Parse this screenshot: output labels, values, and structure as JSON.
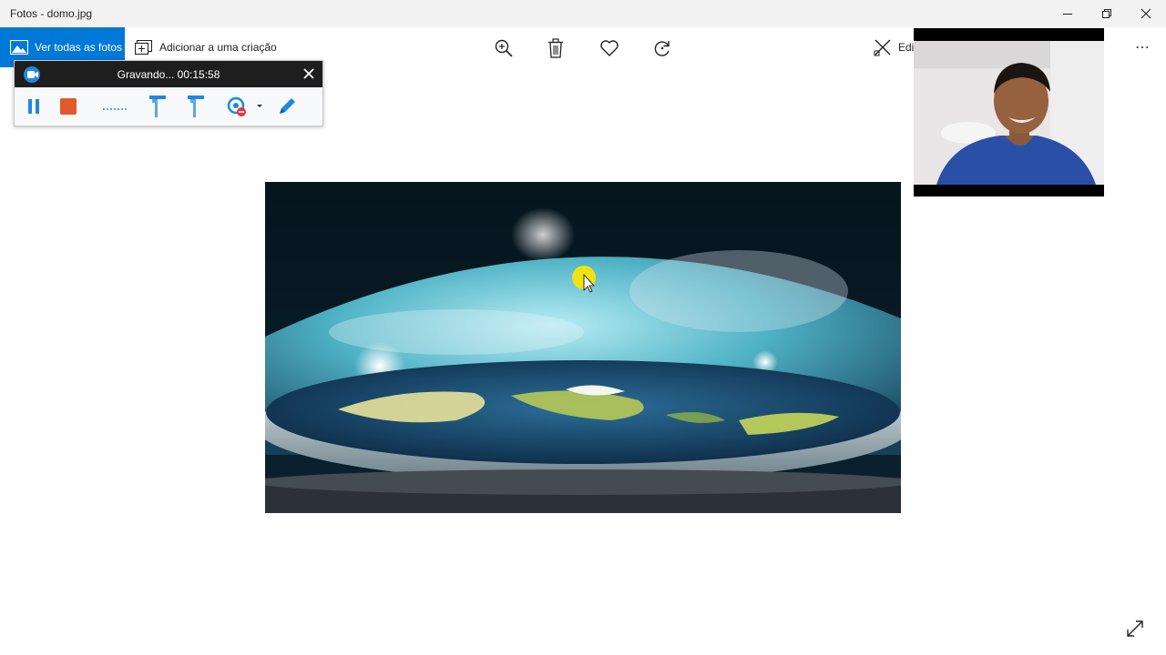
{
  "window": {
    "title": "Fotos - domo.jpg",
    "controls": [
      "minimize-icon",
      "restore-icon",
      "close-icon"
    ]
  },
  "toolbar": {
    "see_all_label": "Ver todas as fotos",
    "add_to_creation_label": "Adicionar a uma criação",
    "tools": [
      "zoom-in-icon",
      "delete-icon",
      "heart-icon",
      "rotate-icon"
    ],
    "edit_label": "Edit",
    "more_label": "⋯"
  },
  "recorder": {
    "status": "Gravando... 00:15:58",
    "tools": [
      "pause-icon",
      "stop-icon",
      "audio-level-icon",
      "pen-left-icon",
      "pen-right-icon",
      "webcam-icon",
      "draw-icon"
    ],
    "accent": "#1e88e5",
    "stop_color": "#e05a2b"
  },
  "photo": {
    "subject": "flat-earth-dome-image"
  },
  "webcam_overlay": {
    "subject": "presenter-webcam"
  },
  "colors": {
    "accent": "#0078d7",
    "titlebar": "#f2f2f2"
  }
}
